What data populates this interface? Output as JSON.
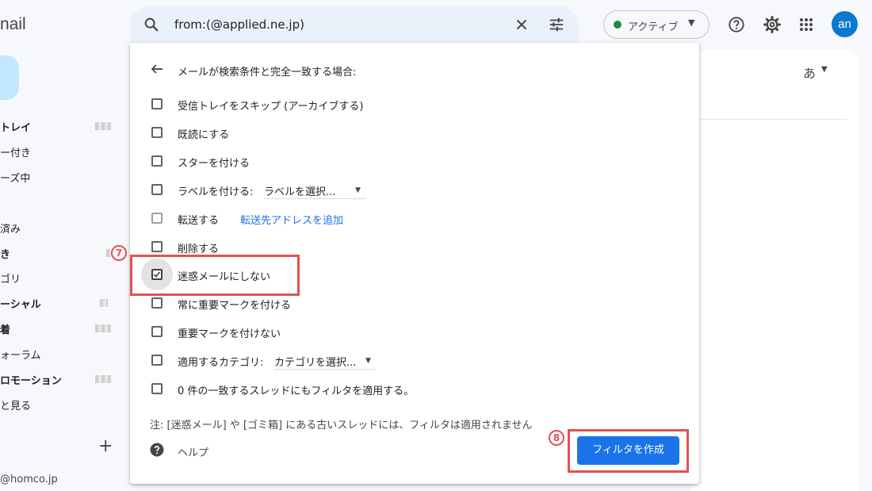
{
  "sidebar": {
    "app_name": "nail",
    "items": [
      {
        "label": "トレイ",
        "bold": true
      },
      {
        "label": "ー付き",
        "bold": false
      },
      {
        "label": "ーズ中",
        "bold": false
      },
      {
        "label": "済み",
        "bold": false
      },
      {
        "label": "き",
        "bold": true
      },
      {
        "label": "ゴリ",
        "bold": false
      },
      {
        "label": "ーシャル",
        "bold": true
      },
      {
        "label": "着",
        "bold": true
      },
      {
        "label": "ォーラム",
        "bold": false
      },
      {
        "label": "ロモーション",
        "bold": true
      },
      {
        "label": "と見る",
        "bold": false
      }
    ],
    "add_label_glyph": "+",
    "account": "@homco.jp"
  },
  "search": {
    "query": "from:(@applied.ne.jp)"
  },
  "topbar": {
    "status_label": "アクティブ",
    "avatar_initials": "an"
  },
  "main": {
    "input_mode": "あ"
  },
  "filter_panel": {
    "title": "メールが検索条件と完全一致する場合:",
    "options": [
      {
        "label": "受信トレイをスキップ (アーカイブする)",
        "checked": false
      },
      {
        "label": "既読にする",
        "checked": false
      },
      {
        "label": "スターを付ける",
        "checked": false
      },
      {
        "label": "ラベルを付ける:",
        "checked": false,
        "select": "ラベルを選択..."
      },
      {
        "label": "転送する",
        "checked": false,
        "link": "転送先アドレスを追加"
      },
      {
        "label": "削除する",
        "checked": false
      },
      {
        "label": "迷惑メールにしない",
        "checked": true
      },
      {
        "label": "常に重要マークを付ける",
        "checked": false
      },
      {
        "label": "重要マークを付けない",
        "checked": false
      },
      {
        "label": "適用するカテゴリ:",
        "checked": false,
        "select": "カテゴリを選択..."
      },
      {
        "label": "0 件の一致するスレッドにもフィルタを適用する。",
        "checked": false
      }
    ],
    "note": "注: [迷惑メール] や [ゴミ箱] にある古いスレッドには、フィルタは適用されません",
    "help_label": "ヘルプ",
    "create_button_label": "フィルタを作成"
  },
  "annotations": {
    "step7": "7",
    "step8": "8"
  },
  "colors": {
    "accent": "#1a73e8",
    "annotation": "#e05252",
    "status_active": "#1e8e3e",
    "avatar": "#0b79d0"
  },
  "icons": [
    "search-icon",
    "close-icon",
    "tune-icon",
    "help-circle-icon",
    "gear-icon",
    "apps-grid-icon",
    "back-arrow-icon",
    "help-icon"
  ]
}
